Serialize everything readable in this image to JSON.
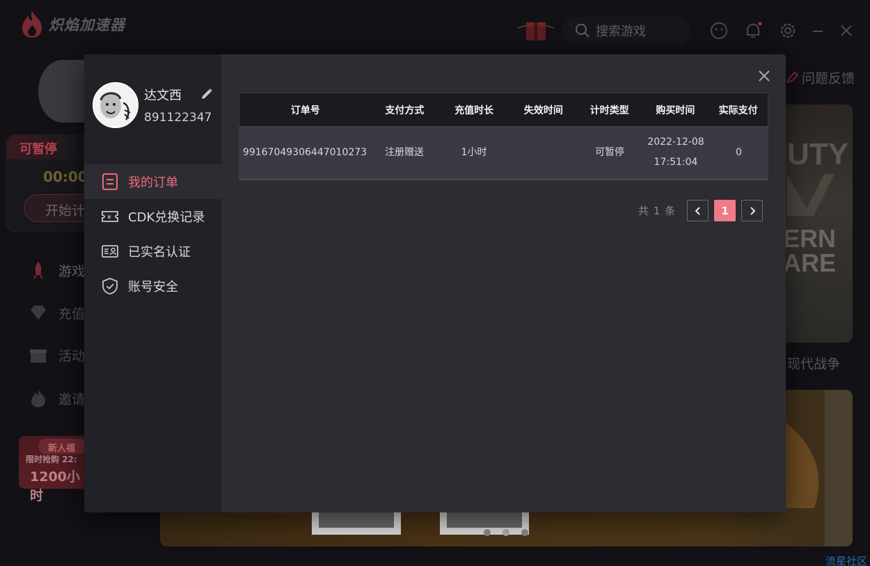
{
  "app": {
    "logo_text": "炽焰加速器",
    "search_placeholder": "搜索游戏",
    "feedback_label": "问题反馈"
  },
  "background": {
    "pause_tag": "可暂停",
    "timer": "00:00:",
    "start_button": "开始计",
    "nav": [
      {
        "label": "游戏",
        "icon": "rocket-icon"
      },
      {
        "label": "充值",
        "icon": "diamond-icon"
      },
      {
        "label": "活动",
        "icon": "gift-icon"
      },
      {
        "label": "邀请",
        "icon": "flame-icon"
      }
    ],
    "promo": {
      "tag": "新人福",
      "line1": "限时抢购 22:",
      "line2": "1200小时"
    },
    "game_card_title": "现代战争",
    "watermark": "流星社区"
  },
  "modal": {
    "user": {
      "name": "达文西",
      "id": "891122347"
    },
    "menu": [
      {
        "label": "我的订单",
        "icon": "order-icon",
        "active": true
      },
      {
        "label": "CDK兑换记录",
        "icon": "ticket-icon",
        "active": false
      },
      {
        "label": "已实名认证",
        "icon": "id-card-icon",
        "active": false
      },
      {
        "label": "账号安全",
        "icon": "shield-icon",
        "active": false
      }
    ],
    "table": {
      "headers": [
        "订单号",
        "支付方式",
        "充值时长",
        "失效时间",
        "计时类型",
        "购买时间",
        "实际支付"
      ],
      "rows": [
        {
          "order_no": "99167049306447010273",
          "pay_method": "注册赠送",
          "duration": "1小时",
          "expire_time": "",
          "timer_type": "可暂停",
          "buy_date": "2022-12-08",
          "buy_time": "17:51:04",
          "paid": "0"
        }
      ]
    },
    "pager": {
      "total_text": "共 1 条",
      "current_page": "1"
    }
  },
  "colors": {
    "accent": "#f06a7a",
    "modal_bg": "#2c2c32",
    "sidebar_bg": "#212127",
    "page_active": "#f07a86"
  }
}
